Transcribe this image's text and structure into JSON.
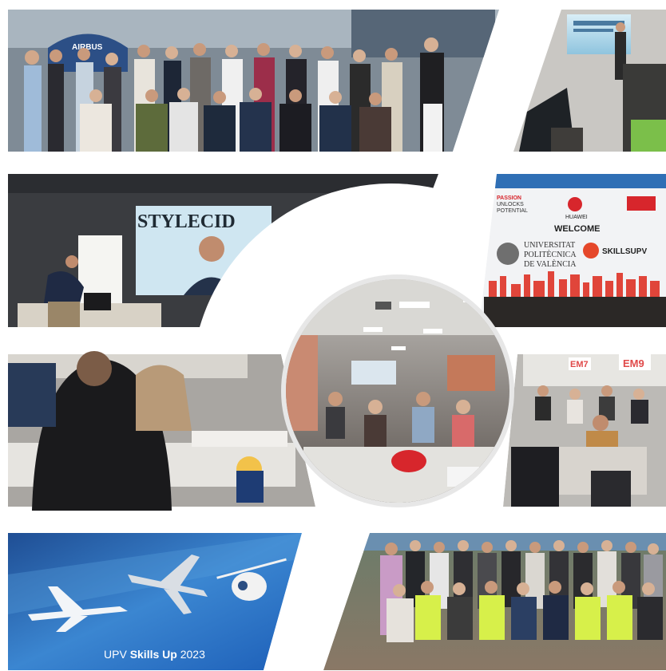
{
  "collage": {
    "tiles": [
      {
        "name": "group-photo-top",
        "scene": "group photo in front of aircraft hall"
      },
      {
        "name": "presentation-room-top-right",
        "scene": "audience watching presentation screen"
      },
      {
        "name": "stylecid-screen",
        "scene": "speaker on video screen"
      },
      {
        "name": "huawei-welcome-banner",
        "scene": "welcome banner"
      },
      {
        "name": "classroom-left",
        "scene": "students in classroom"
      },
      {
        "name": "center-circle-room",
        "scene": "students in lecture hall"
      },
      {
        "name": "em-room-right",
        "scene": "students seated in room with EM signs"
      },
      {
        "name": "aircraft-banner",
        "scene": "aircraft illustration"
      },
      {
        "name": "group-photo-bottom",
        "scene": "large group photo outdoors"
      }
    ]
  },
  "texts": {
    "airbus_sign": "AIRBUS",
    "stylecid": "STYLECID",
    "passion_line1": "PASSION",
    "passion_line2": "UNLOCKS",
    "passion_line3": "POTENTIAL",
    "huawei": "HUAWEI",
    "welcome": "WELCOME",
    "upv_line1": "UNIVERSITAT",
    "upv_line2": "POLITÈCNICA",
    "upv_line3": "DE VALÈNCIA",
    "skills_upv": "SKILLSUPV",
    "em7": "EM7",
    "em9": "EM9",
    "banner_prefix": "UPV ",
    "banner_bold": "Skills Up",
    "banner_suffix": " 2023"
  },
  "colors": {
    "banner_blue": "#1f5fb0",
    "red_accent": "#d7262c",
    "em_sign": "#e04a4a"
  }
}
